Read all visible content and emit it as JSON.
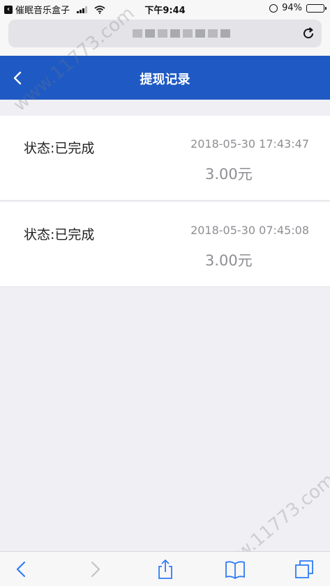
{
  "status_bar": {
    "back_app": "催眠音乐盒子",
    "time": "下午9:44",
    "battery": "94%",
    "battery_level": 0.94
  },
  "nav": {
    "title": "提现记录"
  },
  "records": [
    {
      "status": "状态:已完成",
      "time": "2018-05-30 17:43:47",
      "amount": "3.00元"
    },
    {
      "status": "状态:已完成",
      "time": "2018-05-30 07:45:08",
      "amount": "3.00元"
    }
  ],
  "watermark": "www.11773.com",
  "colors": {
    "nav_blue": "#1f5ac4",
    "page_bg": "#efeff4",
    "muted_text": "#8e8e93",
    "ios_blue": "#2f7cf6"
  },
  "icons": {
    "nav_back": "chevron-left-icon",
    "reload": "reload-icon",
    "share": "share-icon",
    "bookmarks": "book-icon",
    "tabs": "tabs-icon"
  }
}
